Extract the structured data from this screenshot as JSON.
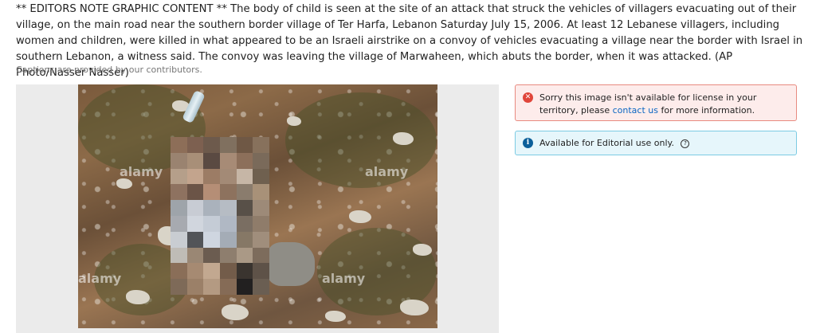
{
  "caption": {
    "text": "** EDITORS NOTE GRAPHIC CONTENT ** The body of child is seen at the site of an attack that struck the vehicles of villagers evacuating out of their village, on the main road near the southern border village of Ter Harfa, Lebanon Saturday July 15, 2006. At least 12 Lebanese villagers, including women and children, were killed in what appeared to be an Israeli airstrike on a convoy of vehicles evacuating a village near the border with Israel in southern Lebanon, a witness said. The convoy was leaving the village of Marwaheen, which abuts the border, when it was attacked. (AP Photo/Nasser Nasser)",
    "contributors_note": "Captions are provided by our contributors."
  },
  "image": {
    "watermark": "alamy"
  },
  "alerts": {
    "error": {
      "text_before": "Sorry this image isn't available for license in your territory, please ",
      "link_text": "contact us",
      "text_after": " for more information."
    },
    "info": {
      "text": "Available for Editorial use only."
    }
  },
  "icons": {
    "error": "x-circle-icon",
    "info": "info-circle-icon",
    "help": "question-circle-icon"
  },
  "colors": {
    "error_bg": "#fdeceb",
    "error_border": "#e88a80",
    "info_bg": "#e6f6fb",
    "info_border": "#7ccbe3",
    "link": "#0a66c2"
  }
}
